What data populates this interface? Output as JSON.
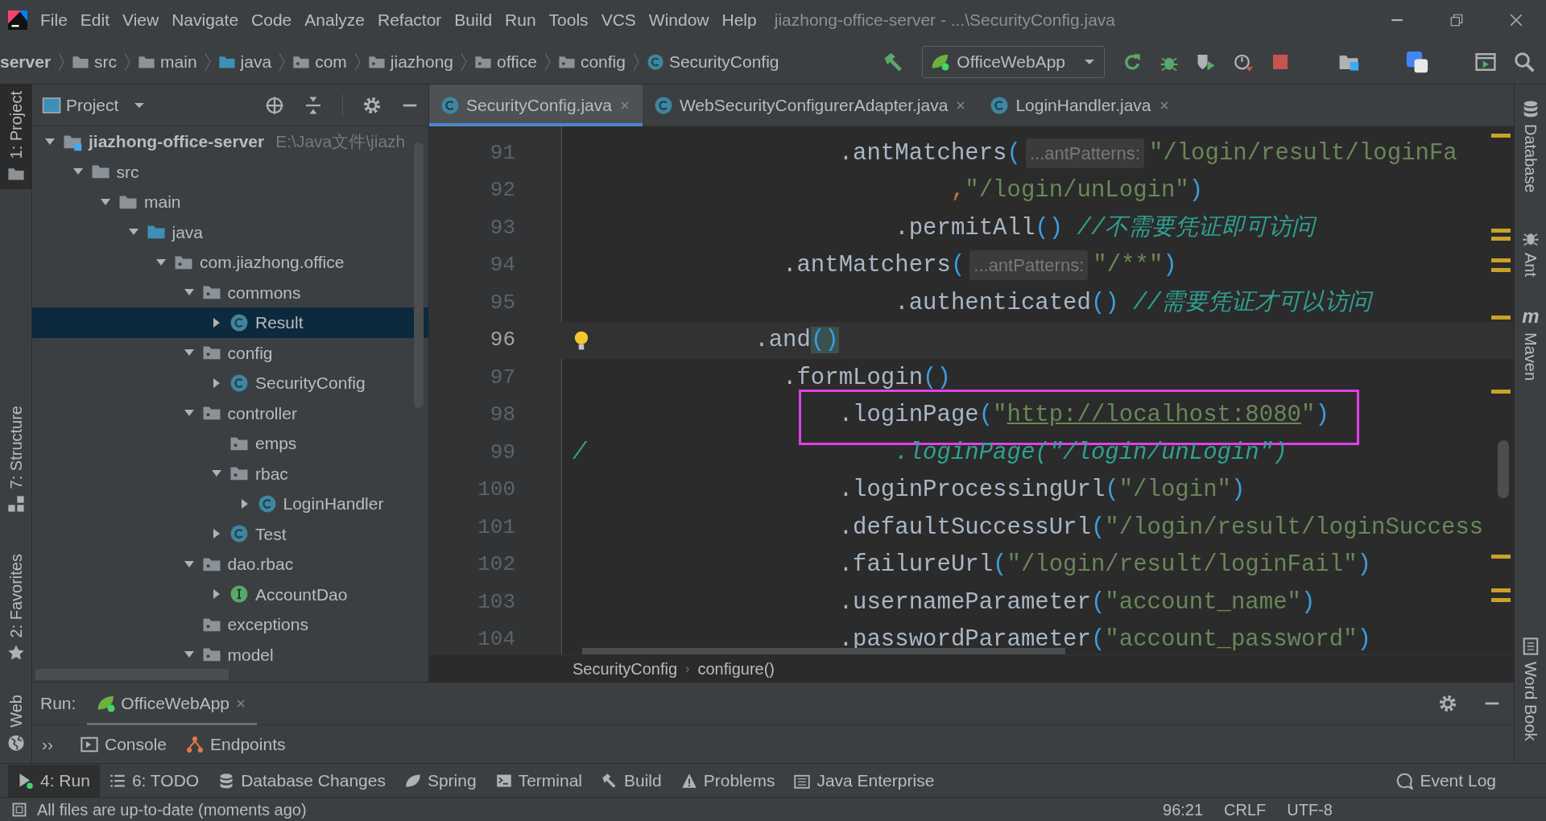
{
  "menu": {
    "items": [
      "File",
      "Edit",
      "View",
      "Navigate",
      "Code",
      "Analyze",
      "Refactor",
      "Build",
      "Run",
      "Tools",
      "VCS",
      "Window",
      "Help"
    ],
    "title": "jiazhong-office-server - ...\\SecurityConfig.java"
  },
  "navigation": {
    "breadcrumbs": [
      {
        "label": "server",
        "kind": "module"
      },
      {
        "label": "src",
        "kind": "folder"
      },
      {
        "label": "main",
        "kind": "folder"
      },
      {
        "label": "java",
        "kind": "source"
      },
      {
        "label": "com",
        "kind": "package"
      },
      {
        "label": "jiazhong",
        "kind": "package"
      },
      {
        "label": "office",
        "kind": "package"
      },
      {
        "label": "config",
        "kind": "package"
      },
      {
        "label": "SecurityConfig",
        "kind": "class"
      }
    ],
    "run_config": "OfficeWebApp"
  },
  "left_stripe": [
    {
      "label": "1: Project",
      "selected": true
    },
    {
      "label": "7: Structure",
      "selected": false
    },
    {
      "label": "2: Favorites",
      "selected": false
    },
    {
      "label": "Web",
      "selected": false
    }
  ],
  "project": {
    "title": "Project",
    "tree": [
      {
        "label": "jiazhong-office-server",
        "path": "E:\\Java文件\\jiazh",
        "kind": "module",
        "expanded": true,
        "selected": false,
        "children": [
          {
            "label": "src",
            "kind": "folder",
            "expanded": true,
            "selected": false,
            "children": [
              {
                "label": "main",
                "kind": "folder",
                "expanded": true,
                "selected": false,
                "children": [
                  {
                    "label": "java",
                    "kind": "source",
                    "expanded": true,
                    "selected": false,
                    "children": [
                      {
                        "label": "com.jiazhong.office",
                        "kind": "package",
                        "expanded": true,
                        "selected": false,
                        "children": [
                          {
                            "label": "commons",
                            "kind": "package",
                            "expanded": true,
                            "selected": false,
                            "children": [
                              {
                                "label": "Result",
                                "kind": "class",
                                "expanded": false,
                                "selected": true
                              }
                            ]
                          },
                          {
                            "label": "config",
                            "kind": "package",
                            "expanded": true,
                            "selected": false,
                            "children": [
                              {
                                "label": "SecurityConfig",
                                "kind": "class",
                                "expanded": false,
                                "selected": false
                              }
                            ]
                          },
                          {
                            "label": "controller",
                            "kind": "package",
                            "expanded": true,
                            "selected": false,
                            "children": [
                              {
                                "label": "emps",
                                "kind": "package",
                                "selected": false
                              },
                              {
                                "label": "rbac",
                                "kind": "package",
                                "expanded": true,
                                "selected": false,
                                "children": [
                                  {
                                    "label": "LoginHandler",
                                    "kind": "class",
                                    "expanded": false,
                                    "selected": false
                                  }
                                ]
                              },
                              {
                                "label": "Test",
                                "kind": "class",
                                "expanded": false,
                                "selected": false
                              }
                            ]
                          },
                          {
                            "label": "dao.rbac",
                            "kind": "package",
                            "expanded": true,
                            "selected": false,
                            "children": [
                              {
                                "label": "AccountDao",
                                "kind": "interface",
                                "expanded": false,
                                "selected": false
                              }
                            ]
                          },
                          {
                            "label": "exceptions",
                            "kind": "package",
                            "selected": false
                          },
                          {
                            "label": "model",
                            "kind": "package",
                            "expanded": true,
                            "selected": false
                          }
                        ]
                      }
                    ]
                  }
                ]
              }
            ]
          }
        ]
      }
    ]
  },
  "editor": {
    "tabs": [
      {
        "label": "SecurityConfig.java",
        "selected": true
      },
      {
        "label": "WebSecurityConfigurerAdapter.java",
        "selected": false
      },
      {
        "label": "LoginHandler.java",
        "selected": false
      }
    ],
    "lines": [
      {
        "number": "91",
        "segments": [
          {
            "kind": "code",
            "tokens": [
              {
                "text": "                   .antMatchers",
                "kind": "plain"
              },
              {
                "text": "(",
                "kind": "paren"
              }
            ]
          },
          {
            "kind": "hint",
            "text": "...antPatterns:"
          },
          {
            "kind": "code",
            "tokens": [
              {
                "text": "\"/login/result/loginFa",
                "kind": "string"
              }
            ]
          }
        ]
      },
      {
        "number": "92",
        "segments": [
          {
            "kind": "code",
            "tokens": [
              {
                "text": "                           ,",
                "kind": "keyword"
              },
              {
                "text": "\"/login/unLogin\"",
                "kind": "string"
              },
              {
                "text": ")",
                "kind": "paren"
              }
            ]
          }
        ]
      },
      {
        "number": "93",
        "segments": [
          {
            "kind": "code",
            "tokens": [
              {
                "text": "                       .permitAll",
                "kind": "plain"
              },
              {
                "text": "()",
                "kind": "paren"
              },
              {
                "text": " //不需要凭证即可访问",
                "kind": "comment"
              }
            ]
          }
        ]
      },
      {
        "number": "94",
        "segments": [
          {
            "kind": "code",
            "tokens": [
              {
                "text": "               .antMatchers",
                "kind": "plain"
              },
              {
                "text": "(",
                "kind": "paren"
              }
            ]
          },
          {
            "kind": "hint",
            "text": "...antPatterns:"
          },
          {
            "kind": "code",
            "tokens": [
              {
                "text": "\"/**\"",
                "kind": "string"
              },
              {
                "text": ")",
                "kind": "paren"
              }
            ]
          }
        ]
      },
      {
        "number": "95",
        "segments": [
          {
            "kind": "code",
            "tokens": [
              {
                "text": "                       .authenticated",
                "kind": "plain"
              },
              {
                "text": "()",
                "kind": "paren"
              },
              {
                "text": " //需要凭证才可以访问",
                "kind": "comment"
              }
            ]
          }
        ]
      },
      {
        "number": "96",
        "current": true,
        "bulb": true,
        "segments": [
          {
            "kind": "code",
            "tokens": [
              {
                "text": "             .and",
                "kind": "plain"
              },
              {
                "text": "()",
                "kind": "matched"
              }
            ]
          }
        ]
      },
      {
        "number": "97",
        "segments": [
          {
            "kind": "code",
            "tokens": [
              {
                "text": "               .formLogin",
                "kind": "plain"
              },
              {
                "text": "()",
                "kind": "paren"
              }
            ]
          }
        ]
      },
      {
        "number": "98",
        "boxed": true,
        "segments": [
          {
            "kind": "code",
            "tokens": [
              {
                "text": "                   .loginPage",
                "kind": "plain"
              },
              {
                "text": "(",
                "kind": "paren"
              },
              {
                "text": "\"",
                "kind": "string"
              },
              {
                "text": "http://localhost:8080",
                "kind": "link"
              },
              {
                "text": "\"",
                "kind": "string"
              },
              {
                "text": ")",
                "kind": "paren"
              }
            ]
          }
        ]
      },
      {
        "number": "99",
        "segments": [
          {
            "kind": "code",
            "tokens": [
              {
                "text": "/                      .loginPage(\"/login/unLogin\")",
                "kind": "comment"
              }
            ]
          }
        ]
      },
      {
        "number": "100",
        "segments": [
          {
            "kind": "code",
            "tokens": [
              {
                "text": "                   .loginProcessingUrl",
                "kind": "plain"
              },
              {
                "text": "(",
                "kind": "paren"
              },
              {
                "text": "\"/login\"",
                "kind": "string"
              },
              {
                "text": ")",
                "kind": "paren"
              }
            ]
          }
        ]
      },
      {
        "number": "101",
        "segments": [
          {
            "kind": "code",
            "tokens": [
              {
                "text": "                   .defaultSuccessUrl",
                "kind": "plain"
              },
              {
                "text": "(",
                "kind": "paren"
              },
              {
                "text": "\"/login/result/loginSuccess",
                "kind": "string"
              }
            ]
          }
        ]
      },
      {
        "number": "102",
        "segments": [
          {
            "kind": "code",
            "tokens": [
              {
                "text": "                   .failureUrl",
                "kind": "plain"
              },
              {
                "text": "(",
                "kind": "paren"
              },
              {
                "text": "\"/login/result/loginFail\"",
                "kind": "string"
              },
              {
                "text": ")",
                "kind": "paren"
              }
            ]
          }
        ]
      },
      {
        "number": "103",
        "segments": [
          {
            "kind": "code",
            "tokens": [
              {
                "text": "                   .usernameParameter",
                "kind": "plain"
              },
              {
                "text": "(",
                "kind": "paren"
              },
              {
                "text": "\"account_name\"",
                "kind": "string"
              },
              {
                "text": ")",
                "kind": "paren"
              }
            ]
          }
        ]
      },
      {
        "number": "104",
        "segments": [
          {
            "kind": "code",
            "tokens": [
              {
                "text": "                   .passwordParameter",
                "kind": "plain"
              },
              {
                "text": "(",
                "kind": "paren"
              },
              {
                "text": "\"account_password\"",
                "kind": "string"
              },
              {
                "text": ")",
                "kind": "paren"
              }
            ]
          }
        ]
      }
    ],
    "breadcrumbs": [
      "SecurityConfig",
      "configure()"
    ]
  },
  "breadcrumb_separator": "›",
  "right_stripe": [
    {
      "label": "Database"
    },
    {
      "label": "Ant"
    },
    {
      "label": "Maven",
      "glyph": "m"
    },
    {
      "label": "Word Book"
    }
  ],
  "run_panel": {
    "label": "Run:",
    "tab": "OfficeWebApp",
    "more": "››",
    "tabs": [
      "Console",
      "Endpoints"
    ]
  },
  "tool_windows": [
    {
      "label": "4: Run",
      "selected": true
    },
    {
      "label": "6: TODO",
      "selected": false
    },
    {
      "label": "Database Changes",
      "selected": false
    },
    {
      "label": "Spring",
      "selected": false
    },
    {
      "label": "Terminal",
      "selected": false
    },
    {
      "label": "Build",
      "selected": false
    },
    {
      "label": "Problems",
      "selected": false
    },
    {
      "label": "Java Enterprise",
      "selected": false
    }
  ],
  "event_log": "Event Log",
  "status_bar": {
    "message": "All files are up-to-date (moments ago)",
    "position": "96:21",
    "line_separator": "CRLF",
    "encoding": "UTF-8"
  }
}
